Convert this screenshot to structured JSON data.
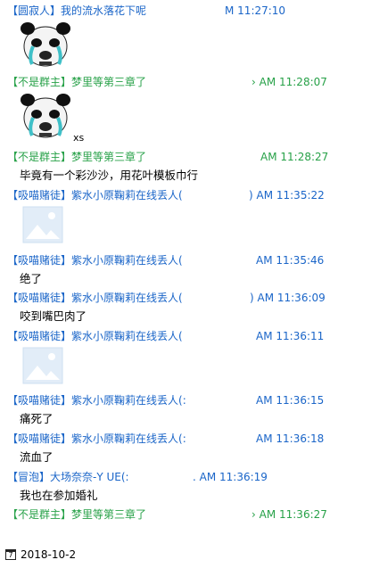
{
  "messages": [
    {
      "role": "【圆寂人】",
      "name": "我的流水落花下呢",
      "time": "M 11:27:10",
      "role_color": "#1a65c8",
      "name_color": "#1a65c8",
      "time_color": "#1a65c8",
      "content_type": "panda_image"
    },
    {
      "role": "【不是群主】",
      "name": "梦里等第三章了",
      "time": "› AM 11:28:07",
      "role_color": "#27a148",
      "name_color": "#27a148",
      "time_color": "#27a148",
      "content_type": "panda_image",
      "suffix": "xs"
    },
    {
      "role": "【不是群主】",
      "name": "梦里等第三章了",
      "time": "AM 11:28:27",
      "role_color": "#27a148",
      "name_color": "#27a148",
      "time_color": "#27a148",
      "content_type": "text",
      "text": "毕竟有一个彩沙沙，用花叶模板巾行"
    },
    {
      "role": "【吸喵赌徒】",
      "name": "紫水小原鞠莉在线丢人(",
      "time": ") AM 11:35:22",
      "role_color": "#1a65c8",
      "name_color": "#1a65c8",
      "time_color": "#1a65c8",
      "content_type": "image_placeholder"
    },
    {
      "role": "【吸喵赌徒】",
      "name": "紫水小原鞠莉在线丢人(",
      "time": "AM 11:35:46",
      "role_color": "#1a65c8",
      "name_color": "#1a65c8",
      "time_color": "#1a65c8",
      "content_type": "text",
      "text": "绝了"
    },
    {
      "role": "【吸喵赌徒】",
      "name": "紫水小原鞠莉在线丢人(",
      "time": ") AM 11:36:09",
      "role_color": "#1a65c8",
      "name_color": "#1a65c8",
      "time_color": "#1a65c8",
      "content_type": "text",
      "text": "咬到嘴巴肉了"
    },
    {
      "role": "【吸喵赌徒】",
      "name": "紫水小原鞠莉在线丢人(",
      "time": "AM 11:36:11",
      "role_color": "#1a65c8",
      "name_color": "#1a65c8",
      "time_color": "#1a65c8",
      "content_type": "image_placeholder"
    },
    {
      "role": "【吸喵赌徒】",
      "name": "紫水小原鞠莉在线丢人(:",
      "time": "AM 11:36:15",
      "role_color": "#1a65c8",
      "name_color": "#1a65c8",
      "time_color": "#1a65c8",
      "content_type": "text",
      "text": "痛死了"
    },
    {
      "role": "【吸喵赌徒】",
      "name": "紫水小原鞠莉在线丢人(:",
      "time": "AM 11:36:18",
      "role_color": "#1a65c8",
      "name_color": "#1a65c8",
      "time_color": "#1a65c8",
      "content_type": "text",
      "text": "流血了"
    },
    {
      "role": "【冒泡】",
      "name": "大场奈奈-Y  UE(:",
      "time": ". AM 11:36:19",
      "role_color": "#1a65c8",
      "name_color": "#1a65c8",
      "time_color": "#1a65c8",
      "content_type": "text",
      "text": "我也在参加婚礼"
    },
    {
      "role": "【不是群主】",
      "name": "梦里等第三章了",
      "time": "› AM 11:36:27",
      "role_color": "#27a148",
      "name_color": "#27a148",
      "time_color": "#27a148",
      "content_type": "none"
    }
  ],
  "footer": {
    "icon": "calendar-icon",
    "icon_glyph": "7",
    "date": "2018-10-2"
  }
}
